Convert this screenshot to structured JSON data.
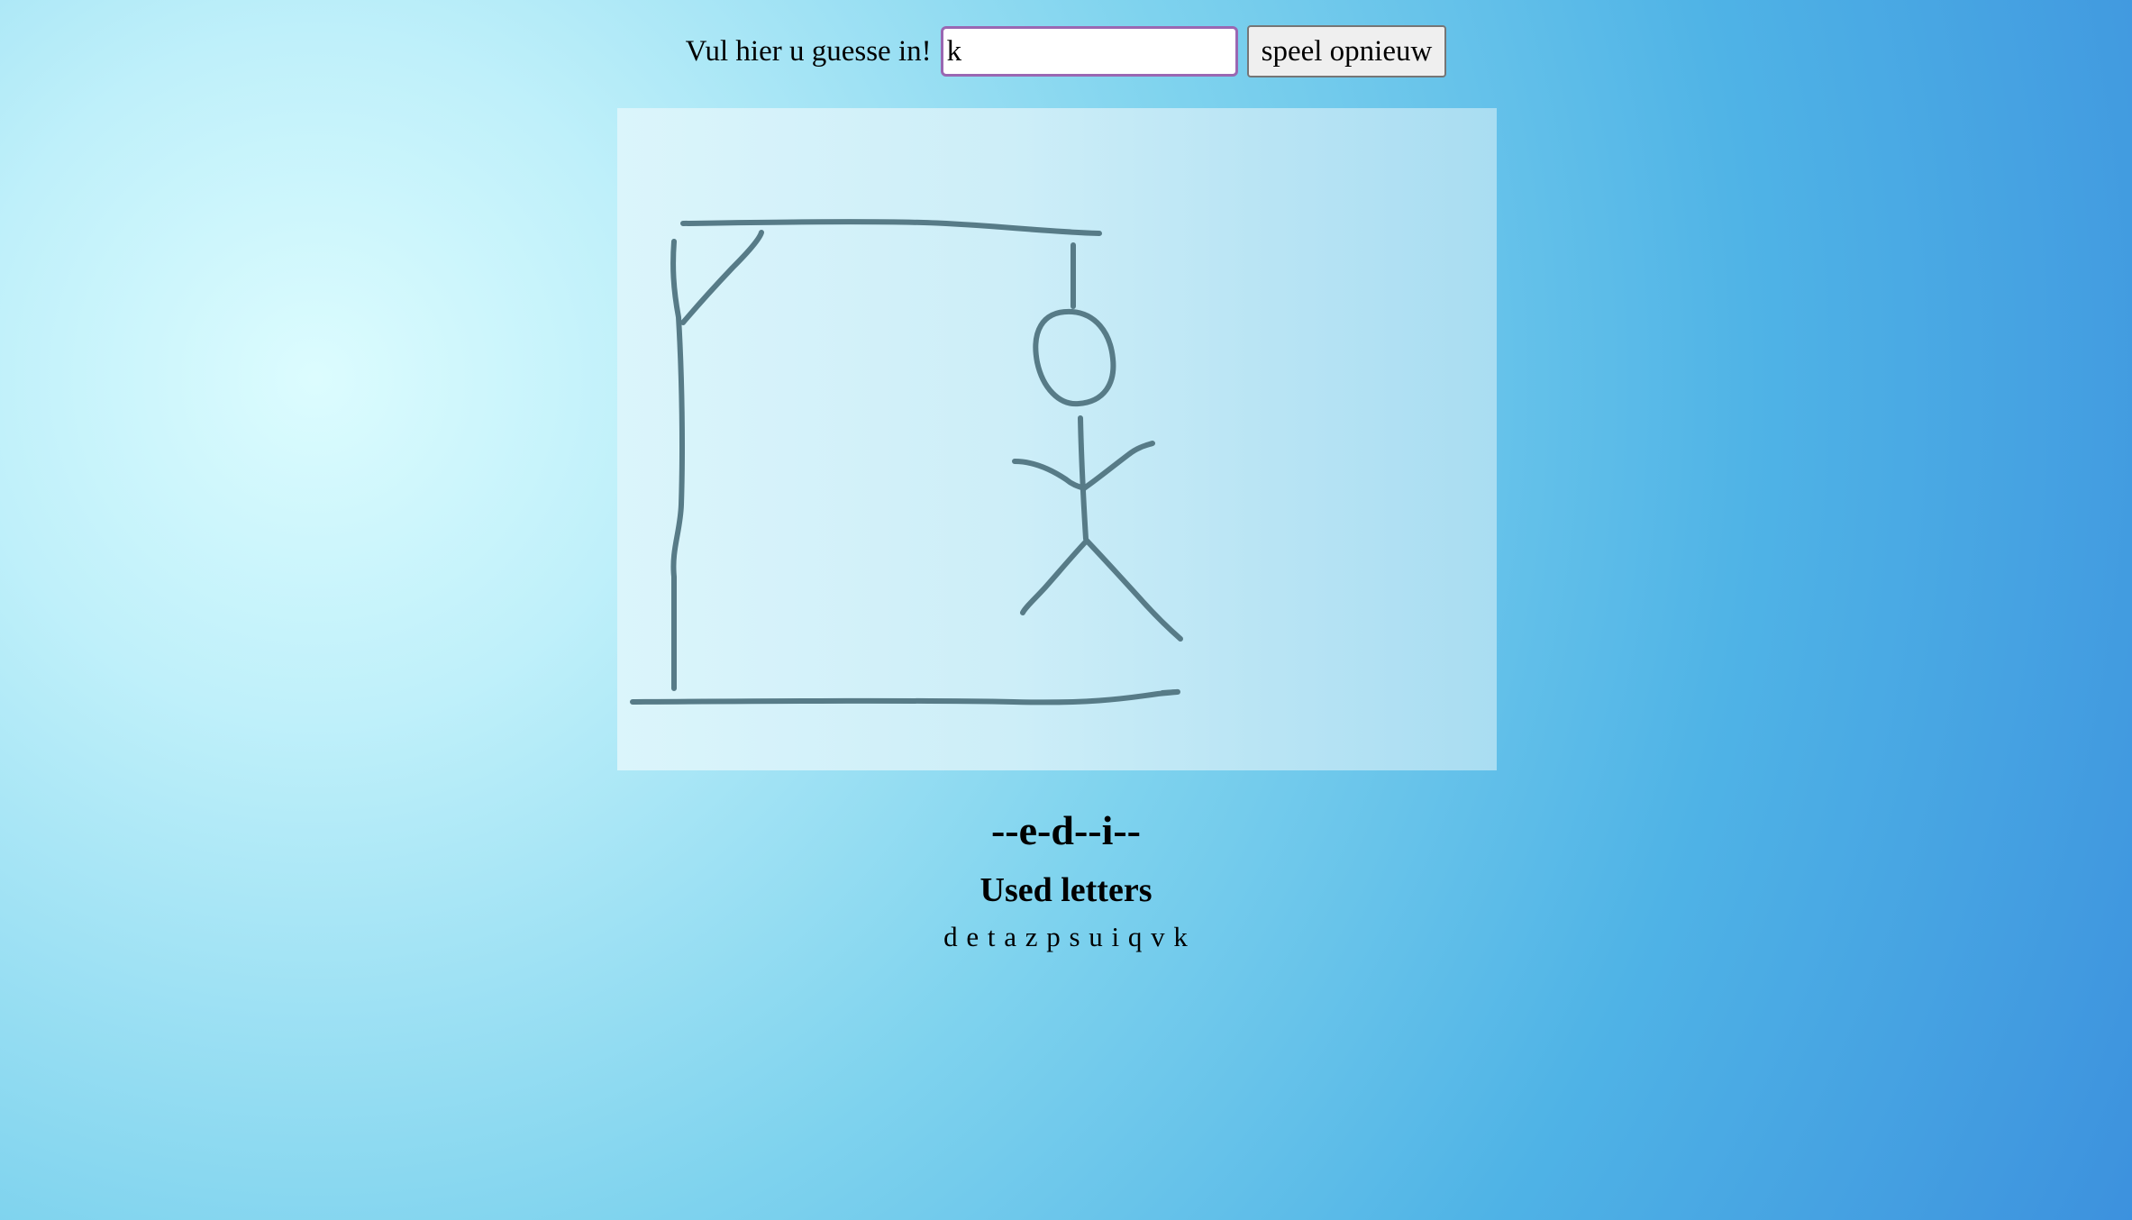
{
  "guess_form": {
    "label": "Vul hier u guesse in!",
    "input_value": "k",
    "replay_label": "speel opnieuw"
  },
  "hangman": {
    "stage": "complete",
    "parts_drawn": [
      "base",
      "pole",
      "beam",
      "brace",
      "rope",
      "head",
      "body",
      "left-arm",
      "right-arm",
      "left-leg",
      "right-leg"
    ]
  },
  "word": {
    "masked": "--e-d--i--"
  },
  "used_letters": {
    "title": "Used letters",
    "letters": "d e t a z p s u i q v k"
  },
  "colors": {
    "drawing_stroke": "#577b87",
    "input_border": "#9a67b2",
    "background_light": "#dcfcfe",
    "background_dark": "#3482da"
  }
}
